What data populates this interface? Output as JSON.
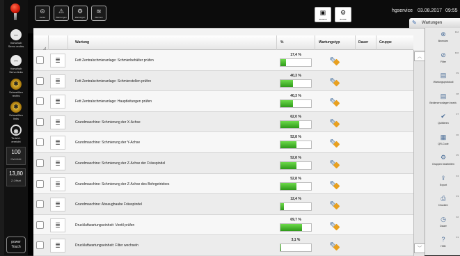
{
  "topbar": {
    "buttons": [
      {
        "label": "Fehler",
        "icon": "error-icon"
      },
      {
        "label": "Warnungen",
        "icon": "warning-icon"
      },
      {
        "label": "Wartungen",
        "icon": "maintenance-icon"
      },
      {
        "label": "Wärmen",
        "icon": "heating-icon"
      }
    ],
    "zustand": "Zustand",
    "zurueck": "Zurück",
    "user": "hgservice",
    "date": "03.08.2017",
    "time": "09:55",
    "active_tab": "Wartungen"
  },
  "left_rail": {
    "items": [
      {
        "label": "Vorschub Servo rechts",
        "glyph": "↔"
      },
      {
        "label": "Vorschub Servo links",
        "glyph": "↔"
      },
      {
        "label": "Schweißen rechts",
        "glyph": "✱"
      },
      {
        "label": "Schweißen links",
        "glyph": "✱"
      },
      {
        "label": "Tinte/A. erreicht",
        "glyph": "◉"
      }
    ],
    "override_value": "100",
    "override_label": "Override",
    "offset_value": "13,80",
    "offset_label": "Z-Offset",
    "power1": "power",
    "power2": "Touch"
  },
  "table": {
    "headers": {
      "wartung": "Wartung",
      "pct": "%",
      "typ": "Wartungstyp",
      "dauer": "Dauer",
      "gruppe": "Gruppe"
    },
    "rows": [
      {
        "name": "Fett Zentralschmieranlage: Schmierbehälter prüfen",
        "pct": "17,4 %",
        "frac": 0.174
      },
      {
        "name": "Fett Zentralschmieranlage: Schmierstellen prüfen",
        "pct": "40,3 %",
        "frac": 0.403
      },
      {
        "name": "Fett Zentralschmieranlage: Hauptleitungen prüfen",
        "pct": "40,3 %",
        "frac": 0.403
      },
      {
        "name": "Grundmaschine: Schmierung der X-Achse",
        "pct": "62,0 %",
        "frac": 0.62
      },
      {
        "name": "Grundmaschine: Schmierung der Y-Achse",
        "pct": "52,8 %",
        "frac": 0.528
      },
      {
        "name": "Grundmaschine: Schmierung der Z-Achse der Frässpindel",
        "pct": "52,8 %",
        "frac": 0.528
      },
      {
        "name": "Grundmaschine: Schmierung der Z-Achse des Bohrgetriebes",
        "pct": "52,8 %",
        "frac": 0.528
      },
      {
        "name": "Grundmaschine: Absaughaube Frässpindel",
        "pct": "12,4 %",
        "frac": 0.124
      },
      {
        "name": "Druckluftwartungseinheit: Ventil prüfen",
        "pct": "69,7 %",
        "frac": 0.697
      },
      {
        "name": "Druckluftwartungseinheit: Filter wechseln",
        "pct": "3,1 %",
        "frac": 0.031
      }
    ]
  },
  "right_rail": {
    "items": [
      {
        "label": "Beenden",
        "key": "F12",
        "glyph": "⊗"
      },
      {
        "label": "Filter",
        "key": "F10",
        "glyph": "⊘"
      },
      {
        "label": "Wartungsprotokoll",
        "key": "F9",
        "glyph": "▤"
      },
      {
        "label": "Bedienervorlagen bearb.",
        "key": "F8",
        "glyph": "▤"
      },
      {
        "label": "Quittieren",
        "key": "F7",
        "glyph": "✔"
      },
      {
        "label": "QR-Code",
        "key": "F6",
        "glyph": "▦"
      },
      {
        "label": "Gruppen bearbeiten",
        "key": "F5",
        "glyph": "⚙"
      },
      {
        "label": "Export",
        "key": "F4",
        "glyph": "⇪"
      },
      {
        "label": "Drucken",
        "key": "F3",
        "glyph": "⎙"
      },
      {
        "label": "Dauer",
        "key": "F2",
        "glyph": "◷"
      },
      {
        "label": "Hilfe",
        "key": "F1",
        "glyph": "?"
      }
    ]
  }
}
